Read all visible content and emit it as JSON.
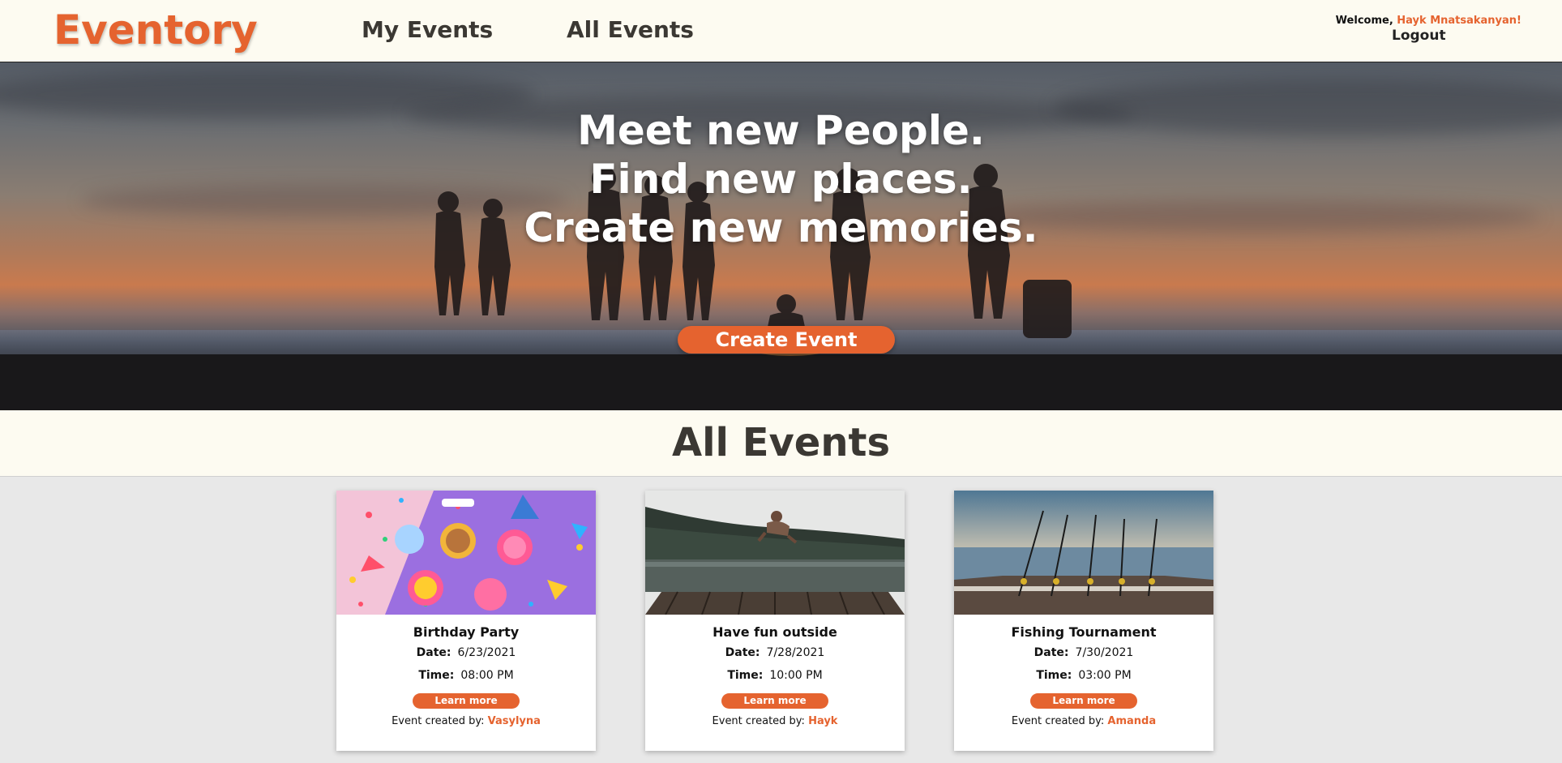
{
  "nav": {
    "logo": "Eventory",
    "links": [
      "My Events",
      "All Events"
    ],
    "welcome_prefix": "Welcome, ",
    "username": "Hayk Mnatsakanyan!",
    "logout": "Logout"
  },
  "hero": {
    "lines": [
      "Meet new People.",
      "Find new places.",
      "Create new memories."
    ],
    "cta": "Create Event"
  },
  "section": {
    "title": "All Events"
  },
  "events": [
    {
      "title": "Birthday Party",
      "date_label": "Date:",
      "date": "6/23/2021",
      "time_label": "Time:",
      "time": "08:00 PM",
      "button": "Learn more",
      "created_by": "Event created by: ",
      "creator": "Vasylyna",
      "image": "party-table-photo"
    },
    {
      "title": "Have fun outside",
      "date_label": "Date:",
      "date": "7/28/2021",
      "time_label": "Time:",
      "time": "10:00 PM",
      "button": "Learn more",
      "created_by": "Event created by: ",
      "creator": "Hayk",
      "image": "lake-jump-photo"
    },
    {
      "title": "Fishing Tournament",
      "date_label": "Date:",
      "date": "7/30/2021",
      "time_label": "Time:",
      "time": "03:00 PM",
      "button": "Learn more",
      "created_by": "Event created by: ",
      "creator": "Amanda",
      "image": "fishing-boat-photo"
    }
  ],
  "colors": {
    "accent": "#e5632f",
    "nav_bg": "#fdfbf1",
    "page_bg": "#e8e8e8",
    "heading": "#3b3833"
  }
}
